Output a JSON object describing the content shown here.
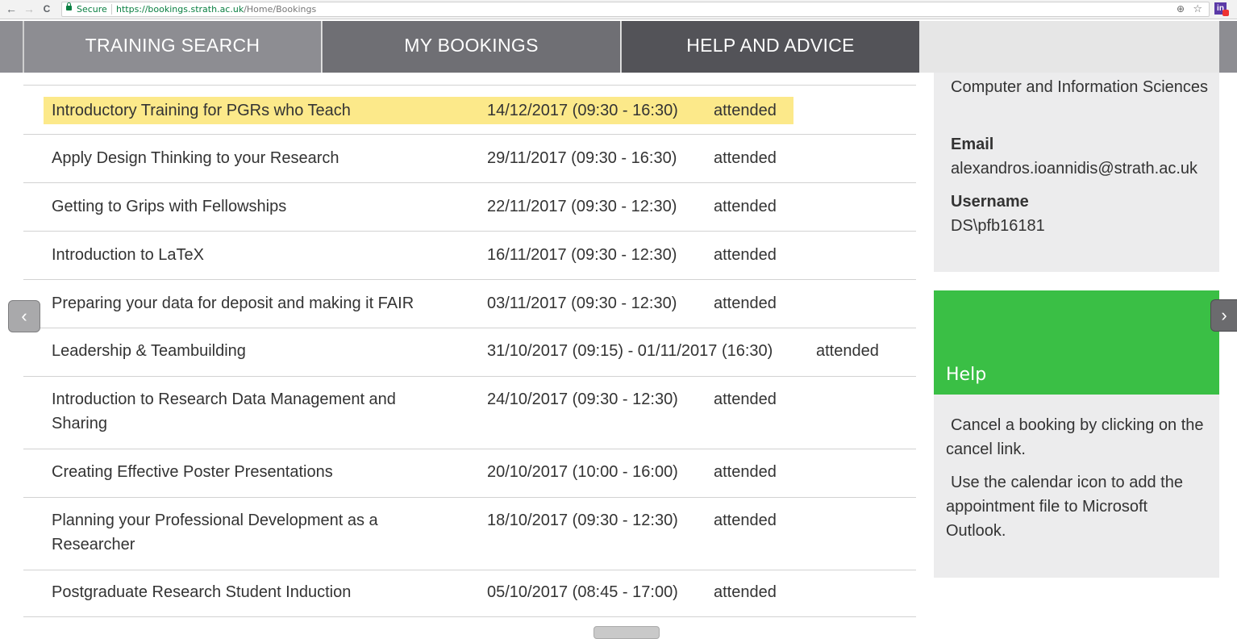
{
  "browser": {
    "back_icon": "←",
    "forward_icon": "→",
    "reload_icon": "C",
    "secure_label": "Secure",
    "url_scheme_host": "https://bookings.strath.ac.uk",
    "url_path": "/Home/Bookings",
    "zoom_icon": "⊕",
    "star_icon": "☆",
    "extension_label": "in"
  },
  "nav": {
    "tabs": [
      {
        "label": "TRAINING SEARCH"
      },
      {
        "label": "MY BOOKINGS"
      },
      {
        "label": "HELP AND ADVICE"
      }
    ]
  },
  "bookings": [
    {
      "title": "Introductory Training for PGRs who Teach",
      "date": "14/12/2017 (09:30 - 16:30)",
      "status": "attended",
      "highlighted": true
    },
    {
      "title": "Apply Design Thinking to your Research",
      "date": "29/11/2017 (09:30 - 16:30)",
      "status": "attended"
    },
    {
      "title": "Getting to Grips with Fellowships",
      "date": "22/11/2017 (09:30 - 12:30)",
      "status": "attended"
    },
    {
      "title": "Introduction to LaTeX",
      "date": "16/11/2017 (09:30 - 12:30)",
      "status": "attended"
    },
    {
      "title": "Preparing your data for deposit and making it FAIR",
      "date": "03/11/2017 (09:30 - 12:30)",
      "status": "attended"
    },
    {
      "title": "Leadership & Teambuilding",
      "date": "31/10/2017 (09:15) - 01/11/2017 (16:30)",
      "status": "attended"
    },
    {
      "title": "Introduction to Research Data Management and Sharing",
      "date": "24/10/2017 (09:30 - 12:30)",
      "status": "attended"
    },
    {
      "title": "Creating Effective Poster Presentations",
      "date": "20/10/2017 (10:00 - 16:00)",
      "status": "attended"
    },
    {
      "title": "Planning your Professional Development as a Researcher",
      "date": "18/10/2017 (09:30 - 12:30)",
      "status": "attended"
    },
    {
      "title": "Postgraduate Research Student Induction",
      "date": "05/10/2017 (08:45 - 17:00)",
      "status": "attended"
    }
  ],
  "profile": {
    "department": "Computer and Information Sciences",
    "email_label": "Email",
    "email": "alexandros.ioannidis@strath.ac.uk",
    "username_label": "Username",
    "username": "DS\\pfb16181"
  },
  "help": {
    "title": "Help",
    "lines": [
      "Cancel a booking by clicking on the cancel link.",
      "Use the calendar icon to add the appointment file to Microsoft Outlook."
    ]
  },
  "carousel": {
    "prev_icon": "‹",
    "next_icon": "›"
  },
  "colors": {
    "highlight": "#fce98a",
    "help_header": "#3abf45",
    "nav_tab_1": "#8d8d92",
    "nav_tab_2": "#6f6f74",
    "nav_tab_3": "#535358"
  }
}
